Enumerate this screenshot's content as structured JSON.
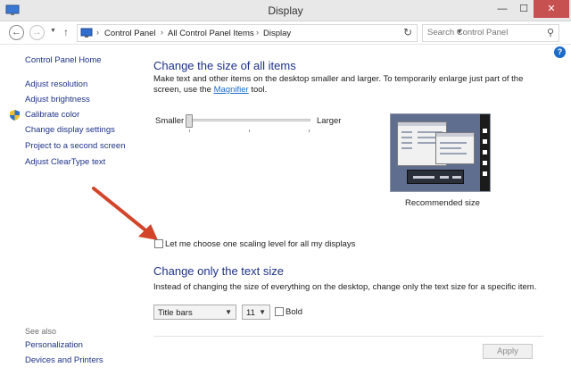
{
  "window": {
    "title": "Display",
    "minimize": "—",
    "maximize": "☐",
    "close": "✕"
  },
  "address_bar": {
    "breadcrumbs": [
      "Control Panel",
      "All Control Panel Items",
      "Display"
    ],
    "search_placeholder": "Search Control Panel"
  },
  "left_nav": {
    "items": [
      "Control Panel Home",
      "Adjust resolution",
      "Adjust brightness",
      "Calibrate color",
      "Change display settings",
      "Project to a second screen",
      "Adjust ClearType text"
    ],
    "see_also_label": "See also",
    "see_also": [
      "Personalization",
      "Devices and Printers"
    ]
  },
  "size_section": {
    "heading": "Change the size of all items",
    "description_part1": "Make text and other items on the desktop smaller and larger. To temporarily enlarge just part of the screen, use the ",
    "magnifier_link": "Magnifier",
    "description_part2": " tool.",
    "slider_min_label": "Smaller",
    "slider_max_label": "Larger",
    "slider_position": 0,
    "preview_caption": "Recommended size"
  },
  "scaling_checkbox": {
    "label": "Let me choose one scaling level for all my displays",
    "checked": false
  },
  "text_section": {
    "heading": "Change only the text size",
    "description": "Instead of changing the size of everything on the desktop, change only the text size for a specific item.",
    "item_select": "Title bars",
    "size_select": "11",
    "bold_label": "Bold",
    "bold_checked": false
  },
  "apply_button": "Apply",
  "colors": {
    "link": "#1e3287",
    "close_button": "#c75050",
    "annotation_arrow": "#d2452a"
  }
}
